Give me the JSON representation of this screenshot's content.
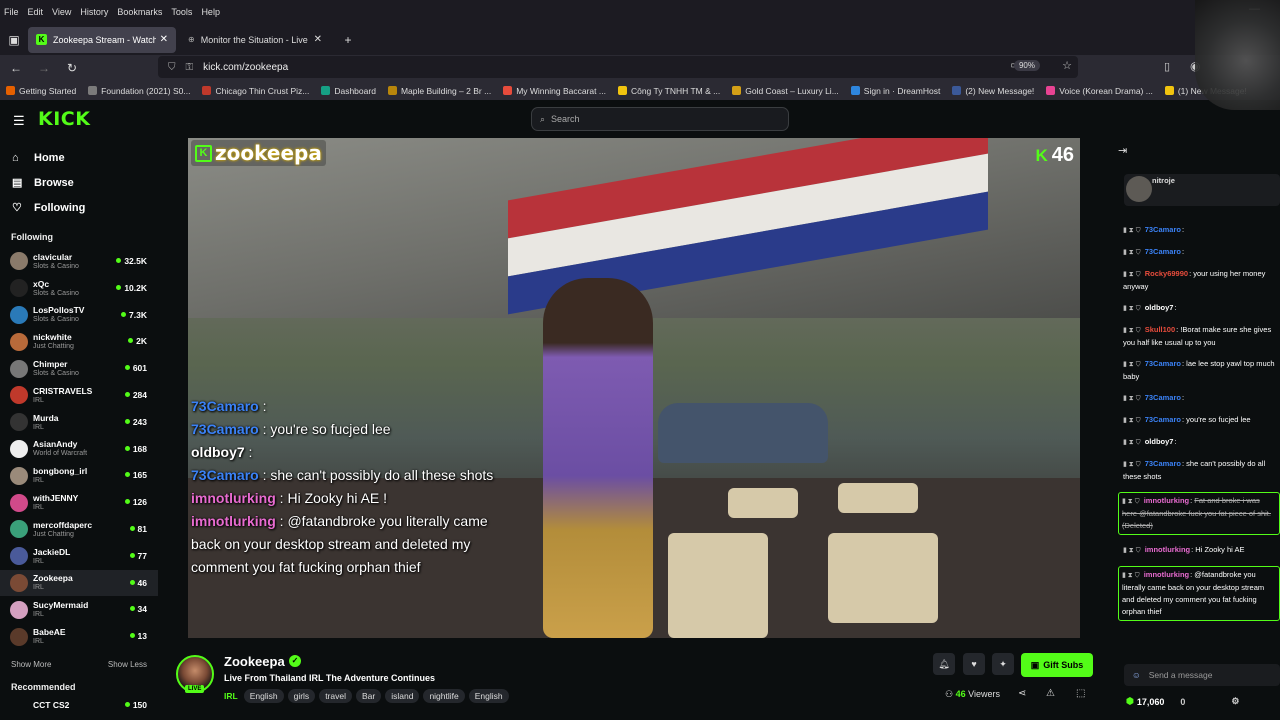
{
  "browser": {
    "menu": [
      "File",
      "Edit",
      "View",
      "History",
      "Bookmarks",
      "Tools",
      "Help"
    ],
    "tabs": [
      {
        "label": "Zookeepa Stream - Watch Li",
        "active": true
      },
      {
        "label": "Monitor the Situation - Live Glob",
        "active": false
      }
    ],
    "url": "kick.com/zookeepa",
    "zoom": "90%",
    "bookmarks": [
      {
        "label": "Getting Started",
        "color": "#e66000"
      },
      {
        "label": "Foundation (2021) S0...",
        "color": "#7b7b7b"
      },
      {
        "label": "Chicago Thin Crust Piz...",
        "color": "#c0392b"
      },
      {
        "label": "Dashboard",
        "color": "#16a085"
      },
      {
        "label": "Maple Building – 2 Br ...",
        "color": "#b8860b"
      },
      {
        "label": "My Winning Baccarat ...",
        "color": "#e74c3c"
      },
      {
        "label": "Công Ty TNHH TM & ...",
        "color": "#f1c40f"
      },
      {
        "label": "Gold Coast – Luxury Li...",
        "color": "#d4a017"
      },
      {
        "label": "Sign in · DreamHost",
        "color": "#2e86de"
      },
      {
        "label": "(2) New Message!",
        "color": "#3b5998"
      },
      {
        "label": "Voice (Korean Drama) ...",
        "color": "#e84393"
      },
      {
        "label": "(1) New Message!",
        "color": "#f1c40f"
      }
    ]
  },
  "kick": {
    "logo": "KICK",
    "search_placeholder": "Search",
    "nav": [
      {
        "label": "Home",
        "icon": "home-icon",
        "glyph": "⌂"
      },
      {
        "label": "Browse",
        "icon": "browse-icon",
        "glyph": "▤"
      },
      {
        "label": "Following",
        "icon": "heart-icon",
        "glyph": "♡"
      }
    ],
    "following_header": "Following",
    "following": [
      {
        "name": "clavicular",
        "cat": "Slots & Casino",
        "viewers": "32.5K",
        "color": "#8a7a6a"
      },
      {
        "name": "xQc",
        "cat": "Slots & Casino",
        "viewers": "10.2K",
        "color": "#222"
      },
      {
        "name": "LosPollosTV",
        "cat": "Slots & Casino",
        "viewers": "7.3K",
        "color": "#2a7ab8"
      },
      {
        "name": "nickwhite",
        "cat": "Just Chatting",
        "viewers": "2K",
        "color": "#b86a3a"
      },
      {
        "name": "Chimper",
        "cat": "Slots & Casino",
        "viewers": "601",
        "color": "#777"
      },
      {
        "name": "CRISTRAVELS",
        "cat": "IRL",
        "viewers": "284",
        "color": "#c0392b"
      },
      {
        "name": "Murda",
        "cat": "IRL",
        "viewers": "243",
        "color": "#333"
      },
      {
        "name": "AsianAndy",
        "cat": "World of Warcraft",
        "viewers": "168",
        "color": "#eee"
      },
      {
        "name": "bongbong_irl",
        "cat": "IRL",
        "viewers": "165",
        "color": "#9a8a7a"
      },
      {
        "name": "withJENNY",
        "cat": "IRL",
        "viewers": "126",
        "color": "#d14a8a"
      },
      {
        "name": "mercoffdaperc",
        "cat": "Just Chatting",
        "viewers": "81",
        "color": "#3aa07a"
      },
      {
        "name": "JackieDL",
        "cat": "IRL",
        "viewers": "77",
        "color": "#4a5a9a"
      },
      {
        "name": "Zookeepa",
        "cat": "IRL",
        "viewers": "46",
        "color": "#7a4a35",
        "active": true
      },
      {
        "name": "SucyMermaid",
        "cat": "IRL",
        "viewers": "34",
        "color": "#d4a0c0"
      },
      {
        "name": "BabeAE",
        "cat": "IRL",
        "viewers": "13",
        "color": "#5a3a2a"
      }
    ],
    "show_more": "Show More",
    "show_less": "Show Less",
    "recommended_header": "Recommended",
    "recommended": [
      {
        "name": "CCT CS2",
        "viewers": "150"
      }
    ]
  },
  "video": {
    "watermark": "zookeepa",
    "viewer_count": "46",
    "overlay_chat": [
      {
        "user": "73Camaro",
        "text": "",
        "ucolor": "#3b82f6"
      },
      {
        "user": "73Camaro",
        "text": "you're so fucjed lee",
        "ucolor": "#3b82f6"
      },
      {
        "user": "oldboy7",
        "text": "",
        "ucolor": "#ffffff"
      },
      {
        "user": "73Camaro",
        "text": "she can't possibly do all these shots",
        "ucolor": "#3b82f6"
      },
      {
        "user": "imnotlurking",
        "text": "Hi Zooky hi AE !",
        "ucolor": "#e86bd0"
      },
      {
        "user": "imnotlurking",
        "text": "@fatandbroke you literally came back on your desktop stream and deleted my comment you fat fucking orphan thief",
        "ucolor": "#e86bd0"
      }
    ]
  },
  "stream": {
    "name": "Zookeepa",
    "title": "Live From Thailand IRL The Adventure Continues",
    "live_badge": "LIVE",
    "category": "IRL",
    "tags": [
      "English",
      "girls",
      "travel",
      "Bar",
      "island",
      "nightlife",
      "English"
    ],
    "viewers": "46",
    "viewers_label": "Viewers",
    "gift_label": "Gift Subs"
  },
  "chat": {
    "pinned_user": "nitroje",
    "messages": [
      {
        "user": "73Camaro",
        "text": "",
        "ucolor": "#3b82f6"
      },
      {
        "user": "73Camaro",
        "text": "",
        "ucolor": "#3b82f6"
      },
      {
        "user": "Rocky69990",
        "text": "your using her money anyway",
        "ucolor": "#e74c3c"
      },
      {
        "user": "oldboy7",
        "text": "",
        "ucolor": "#ffffff"
      },
      {
        "user": "Skull100",
        "text": "!Borat make sure she gives you half like usual up to you",
        "ucolor": "#e74c3c"
      },
      {
        "user": "73Camaro",
        "text": "lae lee stop yawl top much baby",
        "ucolor": "#3b82f6"
      },
      {
        "user": "73Camaro",
        "text": "",
        "ucolor": "#3b82f6"
      },
      {
        "user": "73Camaro",
        "text": "you're so fucjed lee",
        "ucolor": "#3b82f6"
      },
      {
        "user": "oldboy7",
        "text": "",
        "ucolor": "#ffffff"
      },
      {
        "user": "73Camaro",
        "text": "she can't possibly do all these shots",
        "ucolor": "#3b82f6"
      },
      {
        "user": "imnotlurking",
        "text": "Fat and broke i was here @fatandbroke fuck you fat piece of shit. (Deleted)",
        "ucolor": "#e86bd0",
        "highlight": true,
        "deleted": true
      },
      {
        "user": "imnotlurking",
        "text": "Hi Zooky hi AE",
        "ucolor": "#e86bd0"
      },
      {
        "user": "imnotlurking",
        "text": "@fatandbroke you literally came back on your desktop stream and deleted my comment you fat fucking orphan thief",
        "ucolor": "#e86bd0",
        "highlight": true
      }
    ],
    "input_placeholder": "Send a message",
    "points": "17,060",
    "count": "0"
  }
}
